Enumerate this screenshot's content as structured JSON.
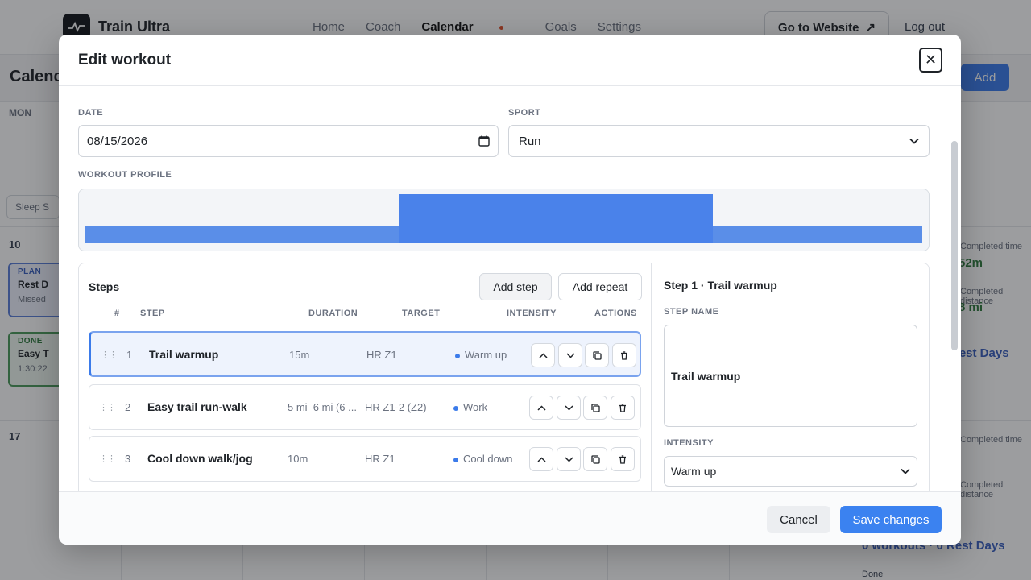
{
  "app": {
    "title": "Train Ultra",
    "nav": [
      "Home",
      "Coach",
      "Calendar",
      "Goals",
      "Settings"
    ],
    "active_nav": "Calendar",
    "website_button": "Go to Website",
    "logout": "Log out"
  },
  "calendar": {
    "heading": "Calendar",
    "add_button": "Add",
    "day_header": "MON",
    "sleep_chip": "Sleep S",
    "week1_day": "10",
    "week2_day": "17",
    "plan_card": {
      "tag": "PLAN",
      "title": "Rest D",
      "status": "Missed"
    },
    "done_card": {
      "tag": "DONE",
      "title": "Easy T",
      "time": "1:30:22"
    },
    "sidebar": {
      "completed_time_label": "Completed time",
      "completed_time_value": "52m",
      "completed_distance_label": "Completed distance",
      "completed_distance_value": "8 mi",
      "rest_days_link": "Rest Days",
      "completed_time_label_2": "Completed time",
      "completed_distance_label_2": "Completed distance",
      "bottom_link": "0 workouts · 0 Rest Days",
      "done_label": "Done"
    }
  },
  "modal": {
    "title": "Edit workout",
    "close_icon": "close-icon",
    "date_label": "DATE",
    "date_value": "08/15/2026",
    "sport_label": "SPORT",
    "sport_value": "Run",
    "profile_label": "WORKOUT PROFILE",
    "profile_blocks": [
      {
        "step": "Trail warmup",
        "intensity_level": 0.35,
        "color": "#5a8ee8"
      },
      {
        "step": "Easy trail run-walk",
        "intensity_level": 1.0,
        "color": "#4a82ea"
      },
      {
        "step": "Cool down walk/jog",
        "intensity_level": 0.35,
        "color": "#5a8ee8"
      }
    ],
    "steps": {
      "title": "Steps",
      "add_step": "Add step",
      "add_repeat": "Add repeat",
      "headers": {
        "num": "#",
        "step": "STEP",
        "duration": "DURATION",
        "target": "TARGET",
        "intensity": "INTENSITY",
        "actions": "ACTIONS"
      },
      "rows": [
        {
          "num": "1",
          "name": "Trail warmup",
          "duration": "15m",
          "target": "HR Z1",
          "intensity": "Warm up"
        },
        {
          "num": "2",
          "name": "Easy trail run-walk",
          "duration": "5 mi–6 mi (6 ...",
          "target": "HR Z1-2 (Z2)",
          "intensity": "Work"
        },
        {
          "num": "3",
          "name": "Cool down walk/jog",
          "duration": "10m",
          "target": "HR Z1",
          "intensity": "Cool down"
        }
      ]
    },
    "detail": {
      "title": "Step 1 · Trail warmup",
      "name_label": "STEP NAME",
      "name_value": "Trail warmup",
      "intensity_label": "INTENSITY",
      "intensity_value": "Warm up"
    },
    "footer": {
      "cancel": "Cancel",
      "save": "Save changes"
    }
  },
  "colors": {
    "accent": "#3b82f0",
    "selected_row_bg": "#eef3fd",
    "done_green": "#2f7a3e",
    "plan_blue": "#3a5fbf"
  }
}
